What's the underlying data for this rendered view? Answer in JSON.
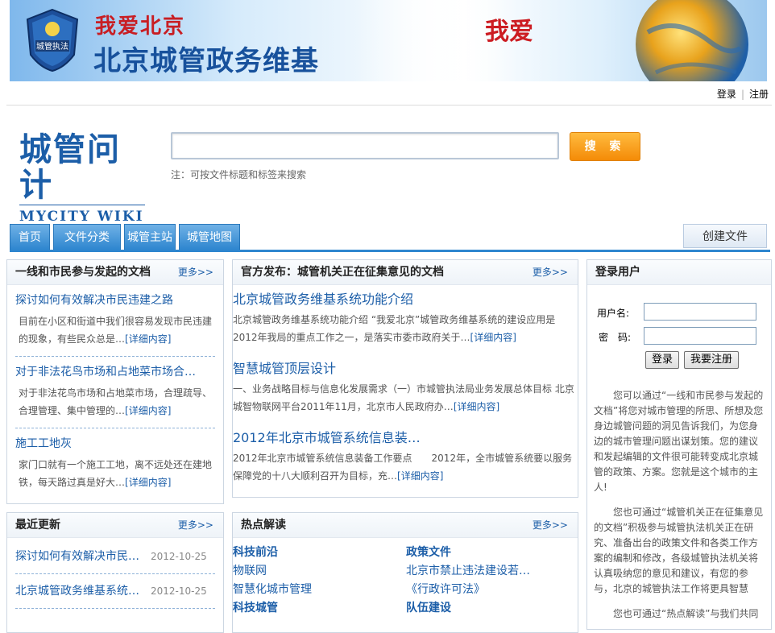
{
  "banner": {
    "badge_text": "城管执法",
    "slogan_small": "我爱北京",
    "title": "北京城管政务维基",
    "slogan_right": "我爱"
  },
  "top_links": {
    "login": "登录",
    "register": "注册"
  },
  "logo": {
    "cn": "城管问计",
    "en": "MYCITY WIKI"
  },
  "search": {
    "button": "搜 索",
    "placeholder": "",
    "note": "注：可按文件标题和标签来搜索"
  },
  "nav": {
    "tabs": [
      "首页",
      "文件分类",
      "城管主站",
      "城管地图"
    ],
    "create": "创建文件"
  },
  "more_label": "更多>>",
  "citizen_docs": {
    "title": "一线和市民参与发起的文档",
    "items": [
      {
        "title": "探讨如何有效解决市民违建之路",
        "desc": "目前在小区和街道中我们很容易发现市民违建的现象，有些民众总是…",
        "detail": "[详细内容]"
      },
      {
        "title": "对于非法花鸟市场和占地菜市场合…",
        "desc": "对于非法花鸟市场和占地菜市场，合理疏导、合理管理、集中管理的…",
        "detail": "[详细内容]"
      },
      {
        "title": "施工工地灰",
        "desc": "家门口就有一个施工工地，离不远处还在建地铁，每天路过真是好大…",
        "detail": "[详细内容]"
      }
    ]
  },
  "official_docs": {
    "title": "官方发布：城管机关正在征集意见的文档",
    "items": [
      {
        "title": "北京城管政务维基系统功能介绍",
        "desc": "北京城管政务维基系统功能介绍 “我爱北京”城管政务维基系统的建设应用是2012年我局的重点工作之一，是落实市委市政府关于…",
        "detail": "[详细内容]"
      },
      {
        "title": "智慧城管顶层设计",
        "desc": "一、业务战略目标与信息化发展需求（一）市城管执法局业务发展总体目标 北京城智物联网平台2011年11月，北京市人民政府办…",
        "detail": "[详细内容]"
      },
      {
        "title": "2012年北京市城管系统信息装…",
        "desc": "2012年北京市城管系统信息装备工作要点　　2012年，全市城管系统要以服务保障党的十八大顺利召开为目标，充…",
        "detail": "[详细内容]"
      }
    ]
  },
  "login_panel": {
    "title": "登录用户",
    "username_label": "用户名:",
    "password_label": "密　码:",
    "login_btn": "登录",
    "register_btn": "我要注册",
    "intro1": "您可以通过“一线和市民参与发起的文档”将您对城市管理的所思、所想及您身边城管问题的洞见告诉我们，为您身边的城市管理问题出谋划策。您的建议和发起编辑的文件很可能转变成北京城管的政策、方案。您就是这个城市的主人!",
    "intro2": "您也可通过“城管机关正在征集意见的文档”积极参与城管执法机关正在研究、准备出台的政策文件和各类工作方案的编制和修改，各级城管执法机关将认真吸纳您的意见和建议，有您的参与，北京的城管执法工作将更具智慧",
    "intro3": "您也可通过“热点解读”与我们共同"
  },
  "recent": {
    "title": "最近更新",
    "items": [
      {
        "title": "探讨如何有效解决市民…",
        "date": "2012-10-25"
      },
      {
        "title": "北京城管政务维基系统…",
        "date": "2012-10-25"
      },
      {
        "title": "",
        "date": ""
      }
    ]
  },
  "hot": {
    "title": "热点解读",
    "left": [
      {
        "text": "科技前沿",
        "bold": true
      },
      {
        "text": "物联网",
        "bold": false
      },
      {
        "text": "智慧化城市管理",
        "bold": false
      },
      {
        "text": "科技城管",
        "bold": true
      }
    ],
    "right": [
      {
        "text": "政策文件",
        "bold": true
      },
      {
        "text": "北京市禁止违法建设若…",
        "bold": false
      },
      {
        "text": "《行政许可法》",
        "bold": false
      },
      {
        "text": "队伍建设",
        "bold": true
      }
    ]
  },
  "colors": {
    "primary_blue": "#1c5ea8",
    "tab_blue": "#2e86cf",
    "orange": "#f48b07"
  }
}
